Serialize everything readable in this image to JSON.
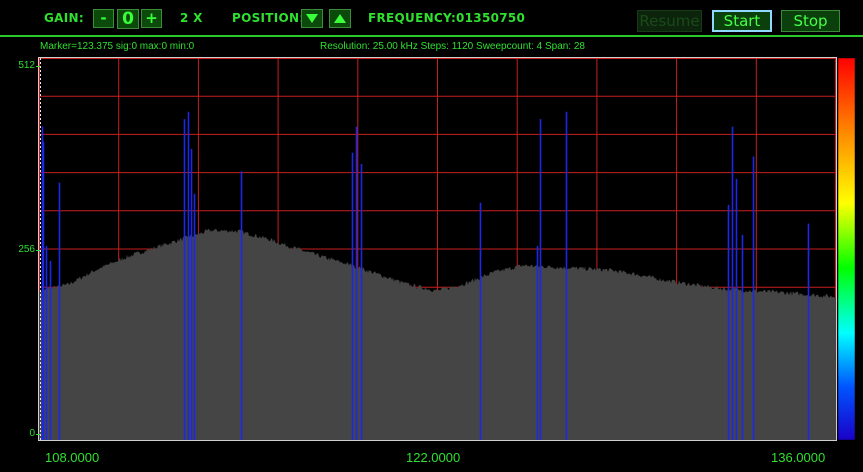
{
  "toolbar": {
    "gain_label": "GAIN:",
    "gain_minus": "-",
    "gain_value": "0",
    "gain_plus": "+",
    "zoom": "2 X",
    "position_label": "POSITION:",
    "frequency_label": "FREQUENCY:",
    "frequency_value": "01350750",
    "resume_label": "Resume",
    "start_label": "Start",
    "stop_label": "Stop"
  },
  "status": {
    "marker": "Marker=123.375 sig:0 max:0 min:0",
    "resolution": "Resolution: 25.00 kHz Steps: 1120 Sweepcount: 4 Span: 28"
  },
  "colors": {
    "text": "#2fe02f",
    "grid": "#c81e1e",
    "noise": "#454545",
    "peak": "#1c28e6",
    "background": "#000000"
  },
  "chart_data": {
    "type": "area",
    "xlabel": "",
    "ylabel": "",
    "x_ticks": [
      "108.0000",
      "122.0000",
      "136.0000"
    ],
    "y_ticks": [
      "512",
      "256",
      "0"
    ],
    "xlim": [
      108.0,
      136.0
    ],
    "ylim": [
      0,
      512
    ],
    "grid": true,
    "legend": "none",
    "series": [
      {
        "type": "area",
        "x": [
          108.0,
          108.5,
          109.0,
          110.0,
          111.0,
          112.0,
          113.0,
          114.0,
          115.0,
          116.0,
          117.0,
          118.0,
          119.0,
          120.0,
          121.0,
          122.0,
          123.0,
          124.0,
          125.0,
          126.0,
          127.0,
          128.0,
          129.0,
          130.0,
          131.0,
          132.0,
          133.0,
          134.0,
          135.0,
          136.0
        ],
        "y": [
          200,
          205,
          208,
          228,
          244,
          257,
          269,
          281,
          280,
          270,
          257,
          245,
          234,
          221,
          208,
          200,
          210,
          225,
          234,
          232,
          230,
          228,
          222,
          214,
          208,
          203,
          200,
          198,
          195,
          192
        ]
      },
      {
        "type": "peaks",
        "x": [
          108.1,
          108.15,
          108.25,
          108.4,
          108.7,
          113.1,
          113.25,
          113.35,
          113.45,
          115.1,
          119.0,
          119.15,
          119.3,
          123.5,
          125.5,
          125.6,
          126.5,
          132.2,
          132.35,
          132.5,
          132.7,
          133.1,
          135.0
        ],
        "y": [
          420,
          400,
          260,
          240,
          345,
          430,
          440,
          390,
          330,
          360,
          385,
          420,
          370,
          318,
          260,
          430,
          440,
          315,
          420,
          350,
          275,
          380,
          290
        ]
      }
    ]
  }
}
